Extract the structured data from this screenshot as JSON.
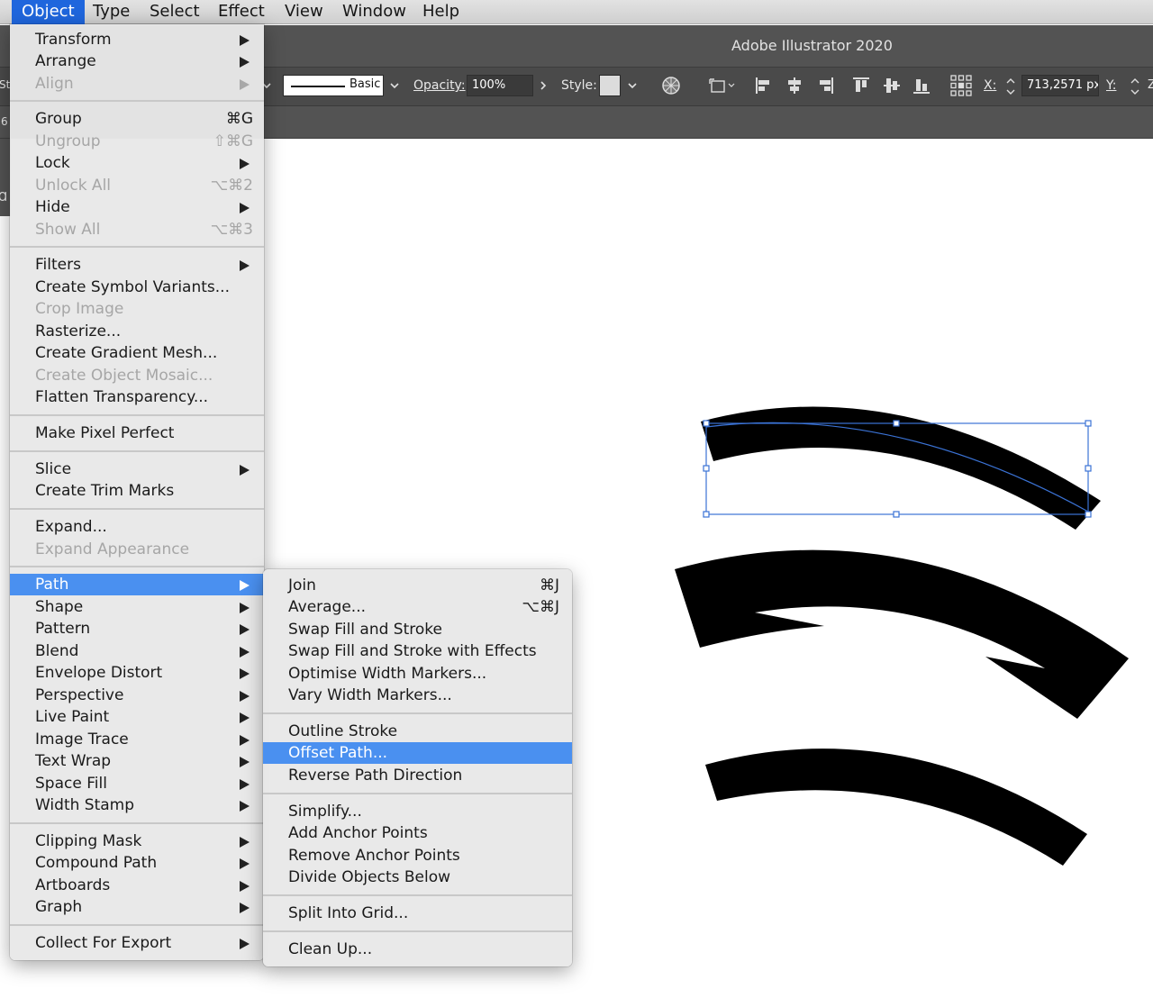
{
  "menubar": {
    "items": [
      "Object",
      "Type",
      "Select",
      "Effect",
      "View",
      "Window",
      "Help"
    ],
    "active": "Object"
  },
  "app": {
    "title": "Adobe Illustrator 2020",
    "left_clip_texts": [
      "St",
      "6",
      "Ɑ"
    ]
  },
  "control_bar": {
    "stroke_profile": "Basic",
    "opacity_label": "Opacity:",
    "opacity_value": "100%",
    "style_label": "Style:",
    "x_label": "X:",
    "x_value": "713,2571 px",
    "y_label": "Y:"
  },
  "object_menu": {
    "items": [
      {
        "label": "Transform",
        "submenu": true
      },
      {
        "label": "Arrange",
        "submenu": true
      },
      {
        "label": "Align",
        "submenu": true,
        "disabled": true
      },
      {
        "label": "Group",
        "shortcut": "⌘G"
      },
      {
        "label": "Ungroup",
        "shortcut": "⇧⌘G",
        "disabled": true
      },
      {
        "label": "Lock",
        "submenu": true
      },
      {
        "label": "Unlock All",
        "shortcut": "⌥⌘2",
        "disabled": true
      },
      {
        "label": "Hide",
        "submenu": true
      },
      {
        "label": "Show All",
        "shortcut": "⌥⌘3",
        "disabled": true
      },
      {
        "label": "Filters",
        "submenu": true
      },
      {
        "label": "Create Symbol Variants..."
      },
      {
        "label": "Crop Image",
        "disabled": true
      },
      {
        "label": "Rasterize..."
      },
      {
        "label": "Create Gradient Mesh..."
      },
      {
        "label": "Create Object Mosaic...",
        "disabled": true
      },
      {
        "label": "Flatten Transparency..."
      },
      {
        "label": "Make Pixel Perfect"
      },
      {
        "label": "Slice",
        "submenu": true
      },
      {
        "label": "Create Trim Marks"
      },
      {
        "label": "Expand..."
      },
      {
        "label": "Expand Appearance",
        "disabled": true
      },
      {
        "label": "Path",
        "submenu": true,
        "highlighted": true
      },
      {
        "label": "Shape",
        "submenu": true
      },
      {
        "label": "Pattern",
        "submenu": true
      },
      {
        "label": "Blend",
        "submenu": true
      },
      {
        "label": "Envelope Distort",
        "submenu": true
      },
      {
        "label": "Perspective",
        "submenu": true
      },
      {
        "label": "Live Paint",
        "submenu": true
      },
      {
        "label": "Image Trace",
        "submenu": true
      },
      {
        "label": "Text Wrap",
        "submenu": true
      },
      {
        "label": "Space Fill",
        "submenu": true
      },
      {
        "label": "Width Stamp",
        "submenu": true
      },
      {
        "label": "Clipping Mask",
        "submenu": true
      },
      {
        "label": "Compound Path",
        "submenu": true
      },
      {
        "label": "Artboards",
        "submenu": true
      },
      {
        "label": "Graph",
        "submenu": true
      },
      {
        "label": "Collect For Export",
        "submenu": true
      }
    ]
  },
  "path_submenu": {
    "items": [
      {
        "label": "Join",
        "shortcut": "⌘J"
      },
      {
        "label": "Average...",
        "shortcut": "⌥⌘J"
      },
      {
        "label": "Swap Fill and Stroke"
      },
      {
        "label": "Swap Fill and Stroke with Effects"
      },
      {
        "label": "Optimise Width Markers..."
      },
      {
        "label": "Vary Width Markers..."
      },
      {
        "label": "Outline Stroke"
      },
      {
        "label": "Offset Path...",
        "highlighted": true
      },
      {
        "label": "Reverse Path Direction"
      },
      {
        "label": "Simplify..."
      },
      {
        "label": "Add Anchor Points"
      },
      {
        "label": "Remove Anchor Points"
      },
      {
        "label": "Divide Objects Below"
      },
      {
        "label": "Split Into Grid..."
      },
      {
        "label": "Clean Up..."
      }
    ]
  },
  "colors": {
    "menu_highlight": "#4a90f0",
    "menubar_active": "#1f66dd",
    "selection": "#3b73d6"
  }
}
